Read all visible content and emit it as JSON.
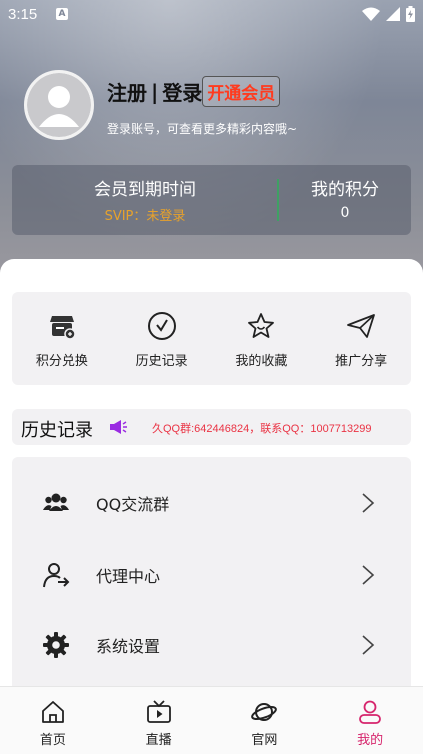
{
  "status_bar": {
    "time": "3:15",
    "notification": "A"
  },
  "header": {
    "register": "注册",
    "separator": "|",
    "login": "登录",
    "vip_button": "开通会员",
    "hint": "登录账号，可查看更多精彩内容哦~"
  },
  "member": {
    "expiry_title": "会员到期时间",
    "expiry_value": "SVIP：未登录",
    "points_title": "我的积分",
    "points_value": "0"
  },
  "quick_actions": [
    {
      "label": "积分兑换",
      "icon": "store-icon"
    },
    {
      "label": "历史记录",
      "icon": "clock-icon"
    },
    {
      "label": "我的收藏",
      "icon": "star-icon"
    },
    {
      "label": "推广分享",
      "icon": "paper-plane-icon"
    }
  ],
  "history": {
    "title": "历史记录",
    "notice": "久QQ群:642446824，联系QQ：1007713299"
  },
  "menu": [
    {
      "label": "QQ交流群",
      "icon": "group-icon"
    },
    {
      "label": "代理中心",
      "icon": "agent-icon"
    },
    {
      "label": "系统设置",
      "icon": "gear-icon"
    }
  ],
  "tabs": [
    {
      "label": "首页",
      "icon": "home-icon"
    },
    {
      "label": "直播",
      "icon": "tv-icon"
    },
    {
      "label": "官网",
      "icon": "planet-icon"
    },
    {
      "label": "我的",
      "icon": "user-icon",
      "active": true
    }
  ],
  "colors": {
    "accent": "#d6246c",
    "vip": "#ff3b1f",
    "svip": "#e7a22c",
    "notice": "#ea3344"
  }
}
